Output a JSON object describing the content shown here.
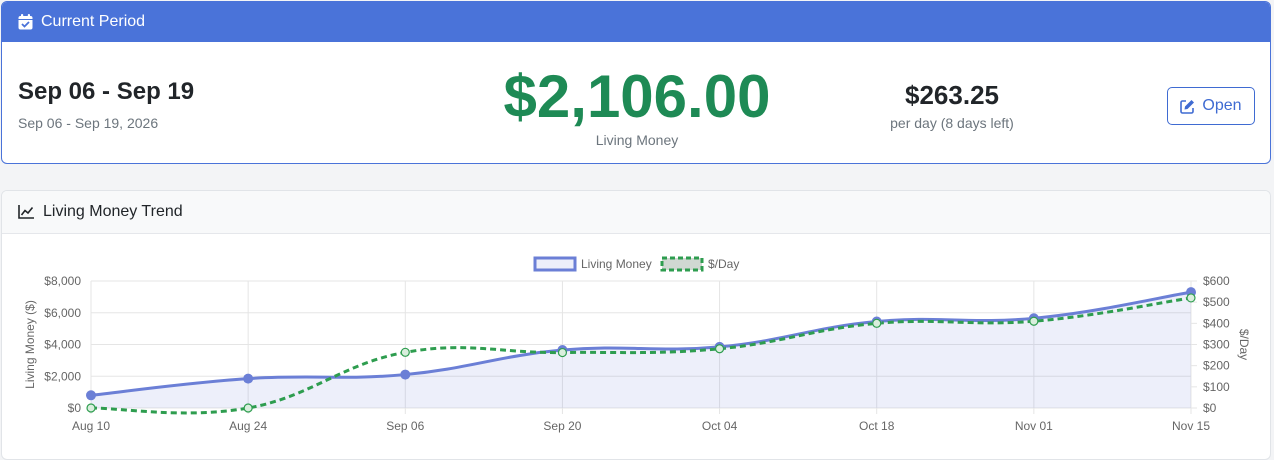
{
  "current_period": {
    "header_title": "Current Period",
    "period_title": "Sep 06 - Sep 19",
    "period_range": "Sep 06 - Sep 19, 2026",
    "living_amount": "$2,106.00",
    "living_label": "Living Money",
    "per_day_amount": "$263.25",
    "per_day_label": "per day (8 days left)",
    "open_button": "Open"
  },
  "trend": {
    "header_title": "Living Money Trend"
  },
  "colors": {
    "header_blue": "#4a73d9",
    "green": "#1e8a55",
    "series_blue": "#6b7fd6",
    "series_green": "#2e9d4f"
  },
  "chart_data": {
    "type": "line",
    "categories": [
      "Aug 10",
      "Aug 24",
      "Sep 06",
      "Sep 20",
      "Oct 04",
      "Oct 18",
      "Nov 01",
      "Nov 15"
    ],
    "series": [
      {
        "name": "Living Money",
        "axis": "left",
        "values": [
          800,
          1850,
          2106,
          3650,
          3850,
          5450,
          5650,
          7300
        ],
        "fill": true
      },
      {
        "name": "$/Day",
        "axis": "right",
        "values": [
          0,
          0,
          263,
          262,
          280,
          400,
          410,
          520
        ],
        "dashed": true
      }
    ],
    "ylabel": "Living Money ($)",
    "y2label": "$/Day",
    "ylim": [
      0,
      8000
    ],
    "y2lim": [
      0,
      600
    ],
    "yticks": [
      "$0",
      "$2,000",
      "$4,000",
      "$6,000",
      "$8,000"
    ],
    "y2ticks": [
      "$0",
      "$100",
      "$200",
      "$300",
      "$400",
      "$500",
      "$600"
    ],
    "grid": true,
    "legend": "top-center"
  }
}
